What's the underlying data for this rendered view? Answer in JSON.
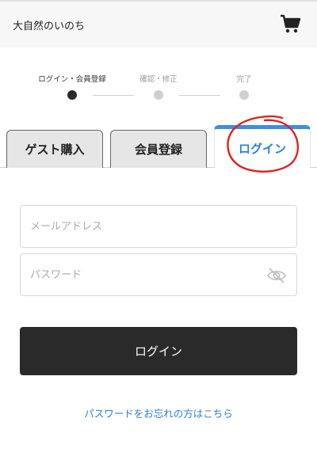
{
  "header": {
    "title": "大自然のいのち",
    "cart_icon": "cart-icon"
  },
  "steps": [
    {
      "label": "ログイン・会員登録",
      "state": "active"
    },
    {
      "label": "確認・修正",
      "state": "inactive"
    },
    {
      "label": "完了",
      "state": "inactive"
    }
  ],
  "tabs": [
    {
      "label": "ゲスト購入",
      "active": false
    },
    {
      "label": "会員登録",
      "active": false
    },
    {
      "label": "ログイン",
      "active": true
    }
  ],
  "form": {
    "email_placeholder": "メールアドレス",
    "password_placeholder": "パスワード",
    "password_toggle_icon": "eye-off-icon",
    "submit_label": "ログイン",
    "forgot_link": "パスワードをお忘れの方はこちら"
  },
  "colors": {
    "accent": "#2e7fd6",
    "tab_active_border": "#3a8ee6",
    "button_bg": "#2a2a2a",
    "annotation": "#e02020"
  }
}
